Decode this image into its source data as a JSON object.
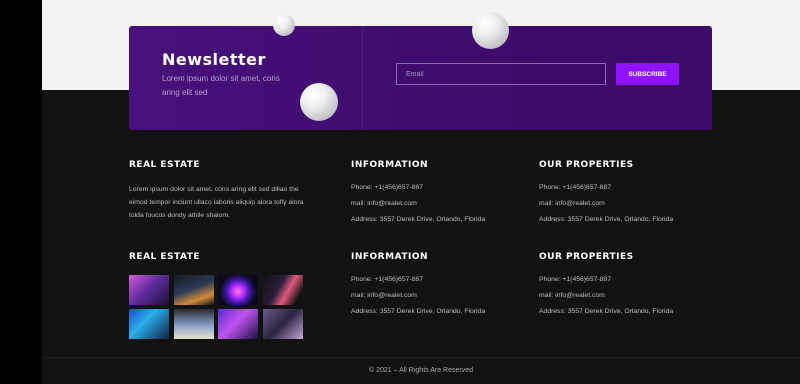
{
  "newsletter": {
    "title": "Newsletter",
    "subtitle": "Lorem ipsum dolor sit amet, cons aring elit sed",
    "email_placeholder": "Email",
    "subscribe_label": "SUBSCRIBE"
  },
  "footer": {
    "about": {
      "title": "REAL ESTATE",
      "text": "Lorem ipsum dolor sit amet, cons aring elit sed dillao the eimod tempor inciunt ullaco laboris aliquip alora tolfy alora tolda foucos dondy athlle shalom."
    },
    "gallery": {
      "title": "REAL ESTATE"
    },
    "info1": {
      "title": "INFORMATION",
      "phone": "Phone: +1(456)657-887",
      "mail": "mail: info@realet.com",
      "address": "Address: 3557 Derek Drive, Orlando, Florida"
    },
    "props1": {
      "title": "OUR PROPERTIES",
      "phone": "Phone: +1(456)657-887",
      "mail": "mail: info@realet.com",
      "address": "Address: 3557 Derek Drive, Orlando, Florida"
    },
    "info2": {
      "title": "INFORMATION",
      "phone": "Phone: +1(456)657-887",
      "mail": "mail: info@realet.com",
      "address": "Address: 3557 Derek Drive, Orlando, Florida"
    },
    "props2": {
      "title": "OUR PROPERTIES",
      "phone": "Phone: +1(456)657-887",
      "mail": "mail: info@realet.com",
      "address": "Address: 3557 Derek Drive, Orlando, Florida"
    },
    "copyright": "© 2021 – All Rights Are Reserved"
  },
  "colors": {
    "accent": "#8f13ff",
    "newsletter_bg": "#47107a",
    "footer_bg": "#121212"
  }
}
